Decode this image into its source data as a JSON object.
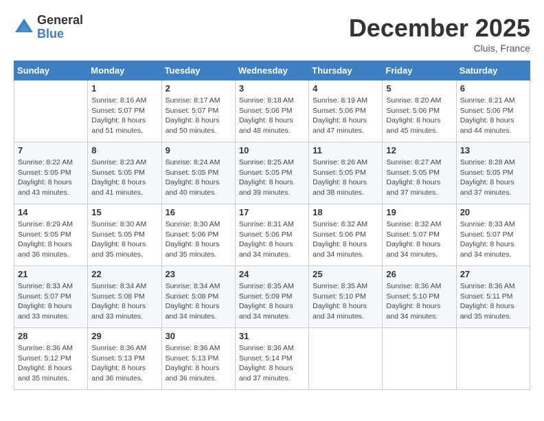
{
  "header": {
    "logo_general": "General",
    "logo_blue": "Blue",
    "month_title": "December 2025",
    "location": "Cluis, France"
  },
  "days_of_week": [
    "Sunday",
    "Monday",
    "Tuesday",
    "Wednesday",
    "Thursday",
    "Friday",
    "Saturday"
  ],
  "weeks": [
    [
      {
        "day": "",
        "info": ""
      },
      {
        "day": "1",
        "info": "Sunrise: 8:16 AM\nSunset: 5:07 PM\nDaylight: 8 hours\nand 51 minutes."
      },
      {
        "day": "2",
        "info": "Sunrise: 8:17 AM\nSunset: 5:07 PM\nDaylight: 8 hours\nand 50 minutes."
      },
      {
        "day": "3",
        "info": "Sunrise: 8:18 AM\nSunset: 5:06 PM\nDaylight: 8 hours\nand 48 minutes."
      },
      {
        "day": "4",
        "info": "Sunrise: 8:19 AM\nSunset: 5:06 PM\nDaylight: 8 hours\nand 47 minutes."
      },
      {
        "day": "5",
        "info": "Sunrise: 8:20 AM\nSunset: 5:06 PM\nDaylight: 8 hours\nand 45 minutes."
      },
      {
        "day": "6",
        "info": "Sunrise: 8:21 AM\nSunset: 5:06 PM\nDaylight: 8 hours\nand 44 minutes."
      }
    ],
    [
      {
        "day": "7",
        "info": "Sunrise: 8:22 AM\nSunset: 5:05 PM\nDaylight: 8 hours\nand 43 minutes."
      },
      {
        "day": "8",
        "info": "Sunrise: 8:23 AM\nSunset: 5:05 PM\nDaylight: 8 hours\nand 41 minutes."
      },
      {
        "day": "9",
        "info": "Sunrise: 8:24 AM\nSunset: 5:05 PM\nDaylight: 8 hours\nand 40 minutes."
      },
      {
        "day": "10",
        "info": "Sunrise: 8:25 AM\nSunset: 5:05 PM\nDaylight: 8 hours\nand 39 minutes."
      },
      {
        "day": "11",
        "info": "Sunrise: 8:26 AM\nSunset: 5:05 PM\nDaylight: 8 hours\nand 38 minutes."
      },
      {
        "day": "12",
        "info": "Sunrise: 8:27 AM\nSunset: 5:05 PM\nDaylight: 8 hours\nand 37 minutes."
      },
      {
        "day": "13",
        "info": "Sunrise: 8:28 AM\nSunset: 5:05 PM\nDaylight: 8 hours\nand 37 minutes."
      }
    ],
    [
      {
        "day": "14",
        "info": "Sunrise: 8:29 AM\nSunset: 5:05 PM\nDaylight: 8 hours\nand 36 minutes."
      },
      {
        "day": "15",
        "info": "Sunrise: 8:30 AM\nSunset: 5:05 PM\nDaylight: 8 hours\nand 35 minutes."
      },
      {
        "day": "16",
        "info": "Sunrise: 8:30 AM\nSunset: 5:06 PM\nDaylight: 8 hours\nand 35 minutes."
      },
      {
        "day": "17",
        "info": "Sunrise: 8:31 AM\nSunset: 5:06 PM\nDaylight: 8 hours\nand 34 minutes."
      },
      {
        "day": "18",
        "info": "Sunrise: 8:32 AM\nSunset: 5:06 PM\nDaylight: 8 hours\nand 34 minutes."
      },
      {
        "day": "19",
        "info": "Sunrise: 8:32 AM\nSunset: 5:07 PM\nDaylight: 8 hours\nand 34 minutes."
      },
      {
        "day": "20",
        "info": "Sunrise: 8:33 AM\nSunset: 5:07 PM\nDaylight: 8 hours\nand 34 minutes."
      }
    ],
    [
      {
        "day": "21",
        "info": "Sunrise: 8:33 AM\nSunset: 5:07 PM\nDaylight: 8 hours\nand 33 minutes."
      },
      {
        "day": "22",
        "info": "Sunrise: 8:34 AM\nSunset: 5:08 PM\nDaylight: 8 hours\nand 33 minutes."
      },
      {
        "day": "23",
        "info": "Sunrise: 8:34 AM\nSunset: 5:08 PM\nDaylight: 8 hours\nand 34 minutes."
      },
      {
        "day": "24",
        "info": "Sunrise: 8:35 AM\nSunset: 5:09 PM\nDaylight: 8 hours\nand 34 minutes."
      },
      {
        "day": "25",
        "info": "Sunrise: 8:35 AM\nSunset: 5:10 PM\nDaylight: 8 hours\nand 34 minutes."
      },
      {
        "day": "26",
        "info": "Sunrise: 8:36 AM\nSunset: 5:10 PM\nDaylight: 8 hours\nand 34 minutes."
      },
      {
        "day": "27",
        "info": "Sunrise: 8:36 AM\nSunset: 5:11 PM\nDaylight: 8 hours\nand 35 minutes."
      }
    ],
    [
      {
        "day": "28",
        "info": "Sunrise: 8:36 AM\nSunset: 5:12 PM\nDaylight: 8 hours\nand 35 minutes."
      },
      {
        "day": "29",
        "info": "Sunrise: 8:36 AM\nSunset: 5:13 PM\nDaylight: 8 hours\nand 36 minutes."
      },
      {
        "day": "30",
        "info": "Sunrise: 8:36 AM\nSunset: 5:13 PM\nDaylight: 8 hours\nand 36 minutes."
      },
      {
        "day": "31",
        "info": "Sunrise: 8:36 AM\nSunset: 5:14 PM\nDaylight: 8 hours\nand 37 minutes."
      },
      {
        "day": "",
        "info": ""
      },
      {
        "day": "",
        "info": ""
      },
      {
        "day": "",
        "info": ""
      }
    ]
  ]
}
